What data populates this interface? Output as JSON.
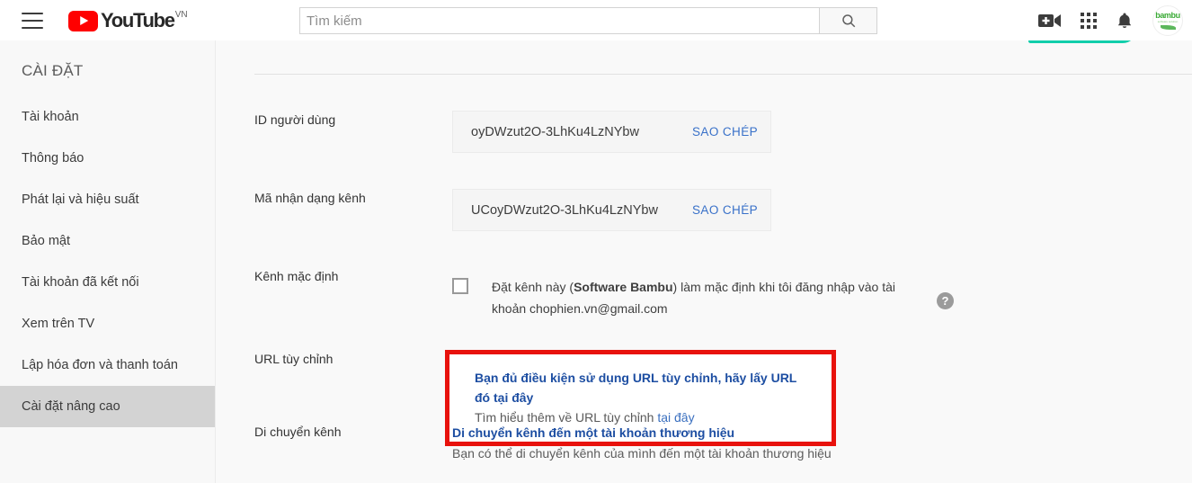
{
  "masthead": {
    "menu_icon": "hamburger-menu-icon",
    "logo_text": "YouTube",
    "logo_country": "VN",
    "search_placeholder": "Tìm kiếm",
    "search_value": "",
    "search_icon": "search-icon",
    "create_icon": "video-camera-plus-icon",
    "apps_icon": "apps-grid-icon",
    "notifications_icon": "bell-icon",
    "avatar_word": "bambu",
    "avatar_sub": "software solution"
  },
  "sidebar": {
    "title": "CÀI ĐẶT",
    "items": [
      {
        "label": "Tài khoản",
        "active": false
      },
      {
        "label": "Thông báo",
        "active": false
      },
      {
        "label": "Phát lại và hiệu suất",
        "active": false
      },
      {
        "label": "Bảo mật",
        "active": false
      },
      {
        "label": "Tài khoản đã kết nối",
        "active": false
      },
      {
        "label": "Xem trên TV",
        "active": false
      },
      {
        "label": "Lập hóa đơn và thanh toán",
        "active": false
      },
      {
        "label": "Cài đặt nâng cao",
        "active": true
      }
    ]
  },
  "main": {
    "user_id": {
      "label": "ID người dùng",
      "value": "oyDWzut2O-3LhKu4LzNYbw",
      "copy_label": "SAO CHÉP"
    },
    "channel_id": {
      "label": "Mã nhận dạng kênh",
      "value": "UCoyDWzut2O-3LhKu4LzNYbw",
      "copy_label": "SAO CHÉP"
    },
    "default_channel": {
      "label": "Kênh mặc định",
      "checked": false,
      "text_before": "Đặt kênh này (",
      "channel_name": "Software Bambu",
      "text_after": ") làm mặc định khi tôi đăng nhập vào tài khoản chophien.vn@gmail.com",
      "help_icon": "help-question-icon"
    },
    "custom_url": {
      "label": "URL tùy chỉnh",
      "link": "Bạn đủ điều kiện sử dụng URL tùy chỉnh, hãy lấy URL đó tại đây",
      "sub_prefix": "Tìm hiểu thêm về URL tùy chỉnh ",
      "sub_link": "tại đây",
      "highlight_color": "#e8120c"
    },
    "move_channel": {
      "label": "Di chuyển kênh",
      "link": "Di chuyển kênh đến một tài khoản thương hiệu",
      "sub": "Bạn có thể di chuyển kênh của mình đến một tài khoản thương hiệu"
    }
  }
}
